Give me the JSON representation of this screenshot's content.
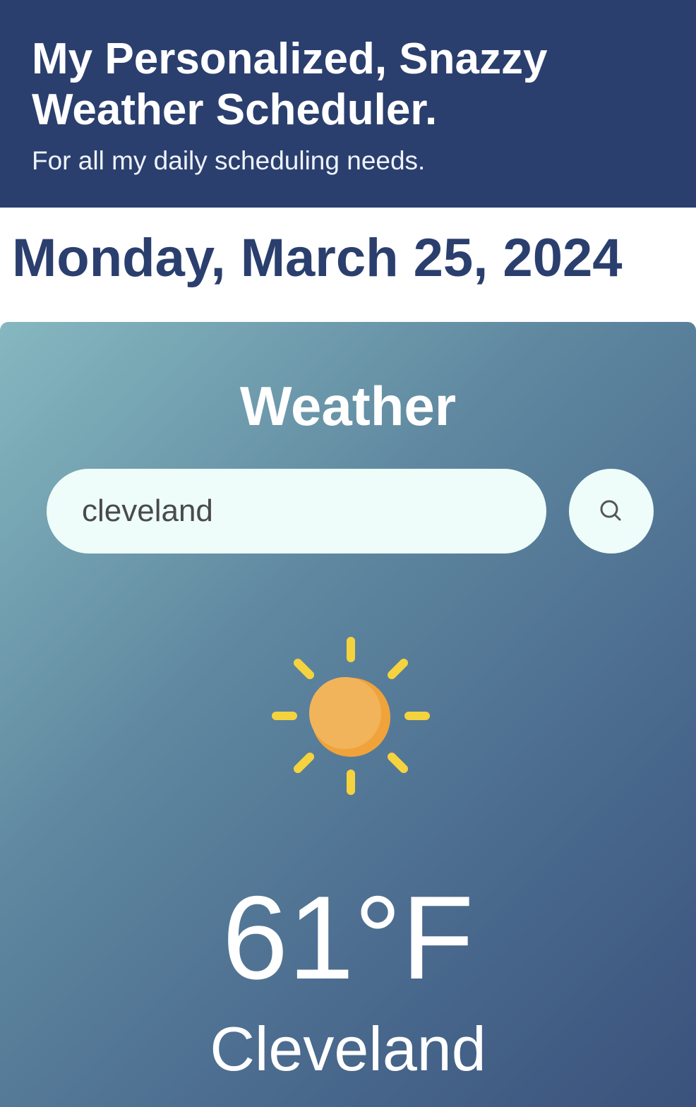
{
  "header": {
    "title": "My Personalized, Snazzy Weather Scheduler.",
    "subtitle": "For all my daily scheduling needs."
  },
  "date": "Monday, March 25, 2024",
  "weather": {
    "heading": "Weather",
    "search": {
      "value": "cleveland",
      "button_icon": "search-icon"
    },
    "condition_icon": "sun-icon",
    "temperature": "61°F",
    "city": "Cleveland"
  },
  "colors": {
    "header_bg": "#2b3f6e",
    "date_text": "#2b3f6e",
    "input_bg": "#eefdf9",
    "sun_body": "#f2b45a",
    "sun_rays": "#f5d33f"
  }
}
